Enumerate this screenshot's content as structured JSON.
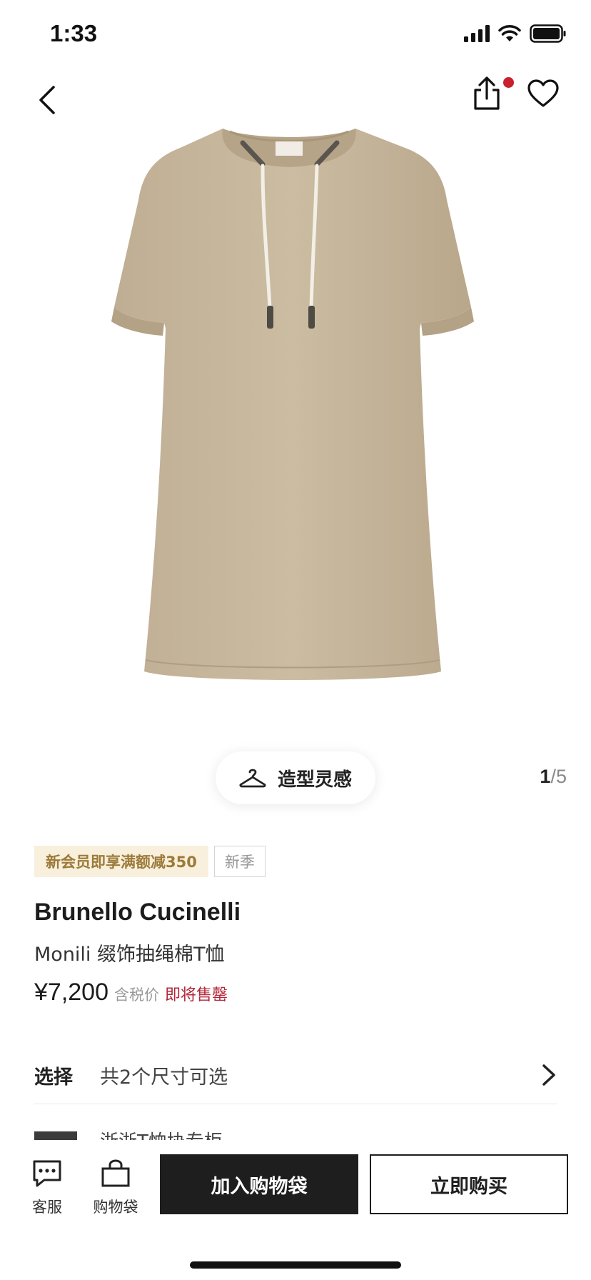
{
  "status_bar": {
    "time": "1:33"
  },
  "gallery": {
    "style_button_label": "造型灵感",
    "current_page": "1",
    "separator": "/",
    "total_pages": "5"
  },
  "tags": {
    "promo": "新会员即享满额减350",
    "season": "新季"
  },
  "product": {
    "brand": "Brunello Cucinelli",
    "name": "Monili 缀饰抽绳棉T恤",
    "price": "¥7,200",
    "tax_note": "含税价",
    "stock_note": "即将售罄"
  },
  "size_select": {
    "title": "选择",
    "value": "共2个尺寸可选"
  },
  "next_row": {
    "text": "浙浙T恤协专柜"
  },
  "bottom_bar": {
    "service_label": "客服",
    "bag_label": "购物袋",
    "add_to_bag": "加入购物袋",
    "buy_now": "立即购买"
  },
  "colors": {
    "accent_red": "#c8202f",
    "price_red": "#b3263a",
    "promo_gold": "#9c7a3a",
    "promo_bg": "#f8f0dc",
    "button_dark": "#1e1e1e",
    "shirt_beige": "#c6b59b"
  },
  "icons": [
    "back-icon",
    "share-icon",
    "heart-icon",
    "hanger-icon",
    "chevron-right-icon",
    "chat-icon",
    "bag-icon"
  ]
}
